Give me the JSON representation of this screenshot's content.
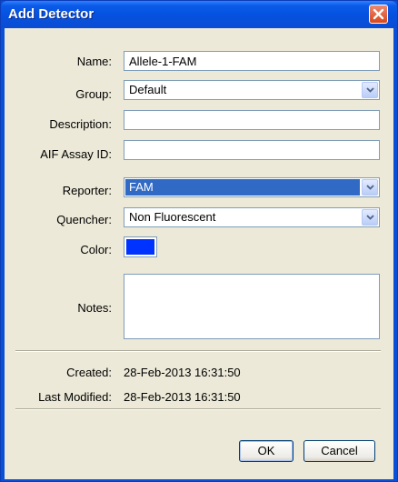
{
  "window": {
    "title": "Add Detector"
  },
  "form": {
    "name_label": "Name:",
    "name_value": "Allele-1-FAM",
    "group_label": "Group:",
    "group_value": "Default",
    "description_label": "Description:",
    "description_value": "",
    "aif_assay_id_label": "AIF Assay ID:",
    "aif_assay_id_value": "",
    "reporter_label": "Reporter:",
    "reporter_value": "FAM",
    "quencher_label": "Quencher:",
    "quencher_value": "Non Fluorescent",
    "color_label": "Color:",
    "color_value": "#0033ff",
    "notes_label": "Notes:",
    "notes_value": ""
  },
  "info": {
    "created_label": "Created:",
    "created_value": "28-Feb-2013 16:31:50",
    "modified_label": "Last Modified:",
    "modified_value": "28-Feb-2013 16:31:50"
  },
  "buttons": {
    "ok_label": "OK",
    "cancel_label": "Cancel"
  },
  "icons": {
    "close": "close-icon",
    "dropdown": "chevron-down-icon"
  },
  "colors": {
    "title_bar": "#0a5ae8",
    "selection": "#316ac5",
    "dialog_face": "#ece9d8"
  }
}
